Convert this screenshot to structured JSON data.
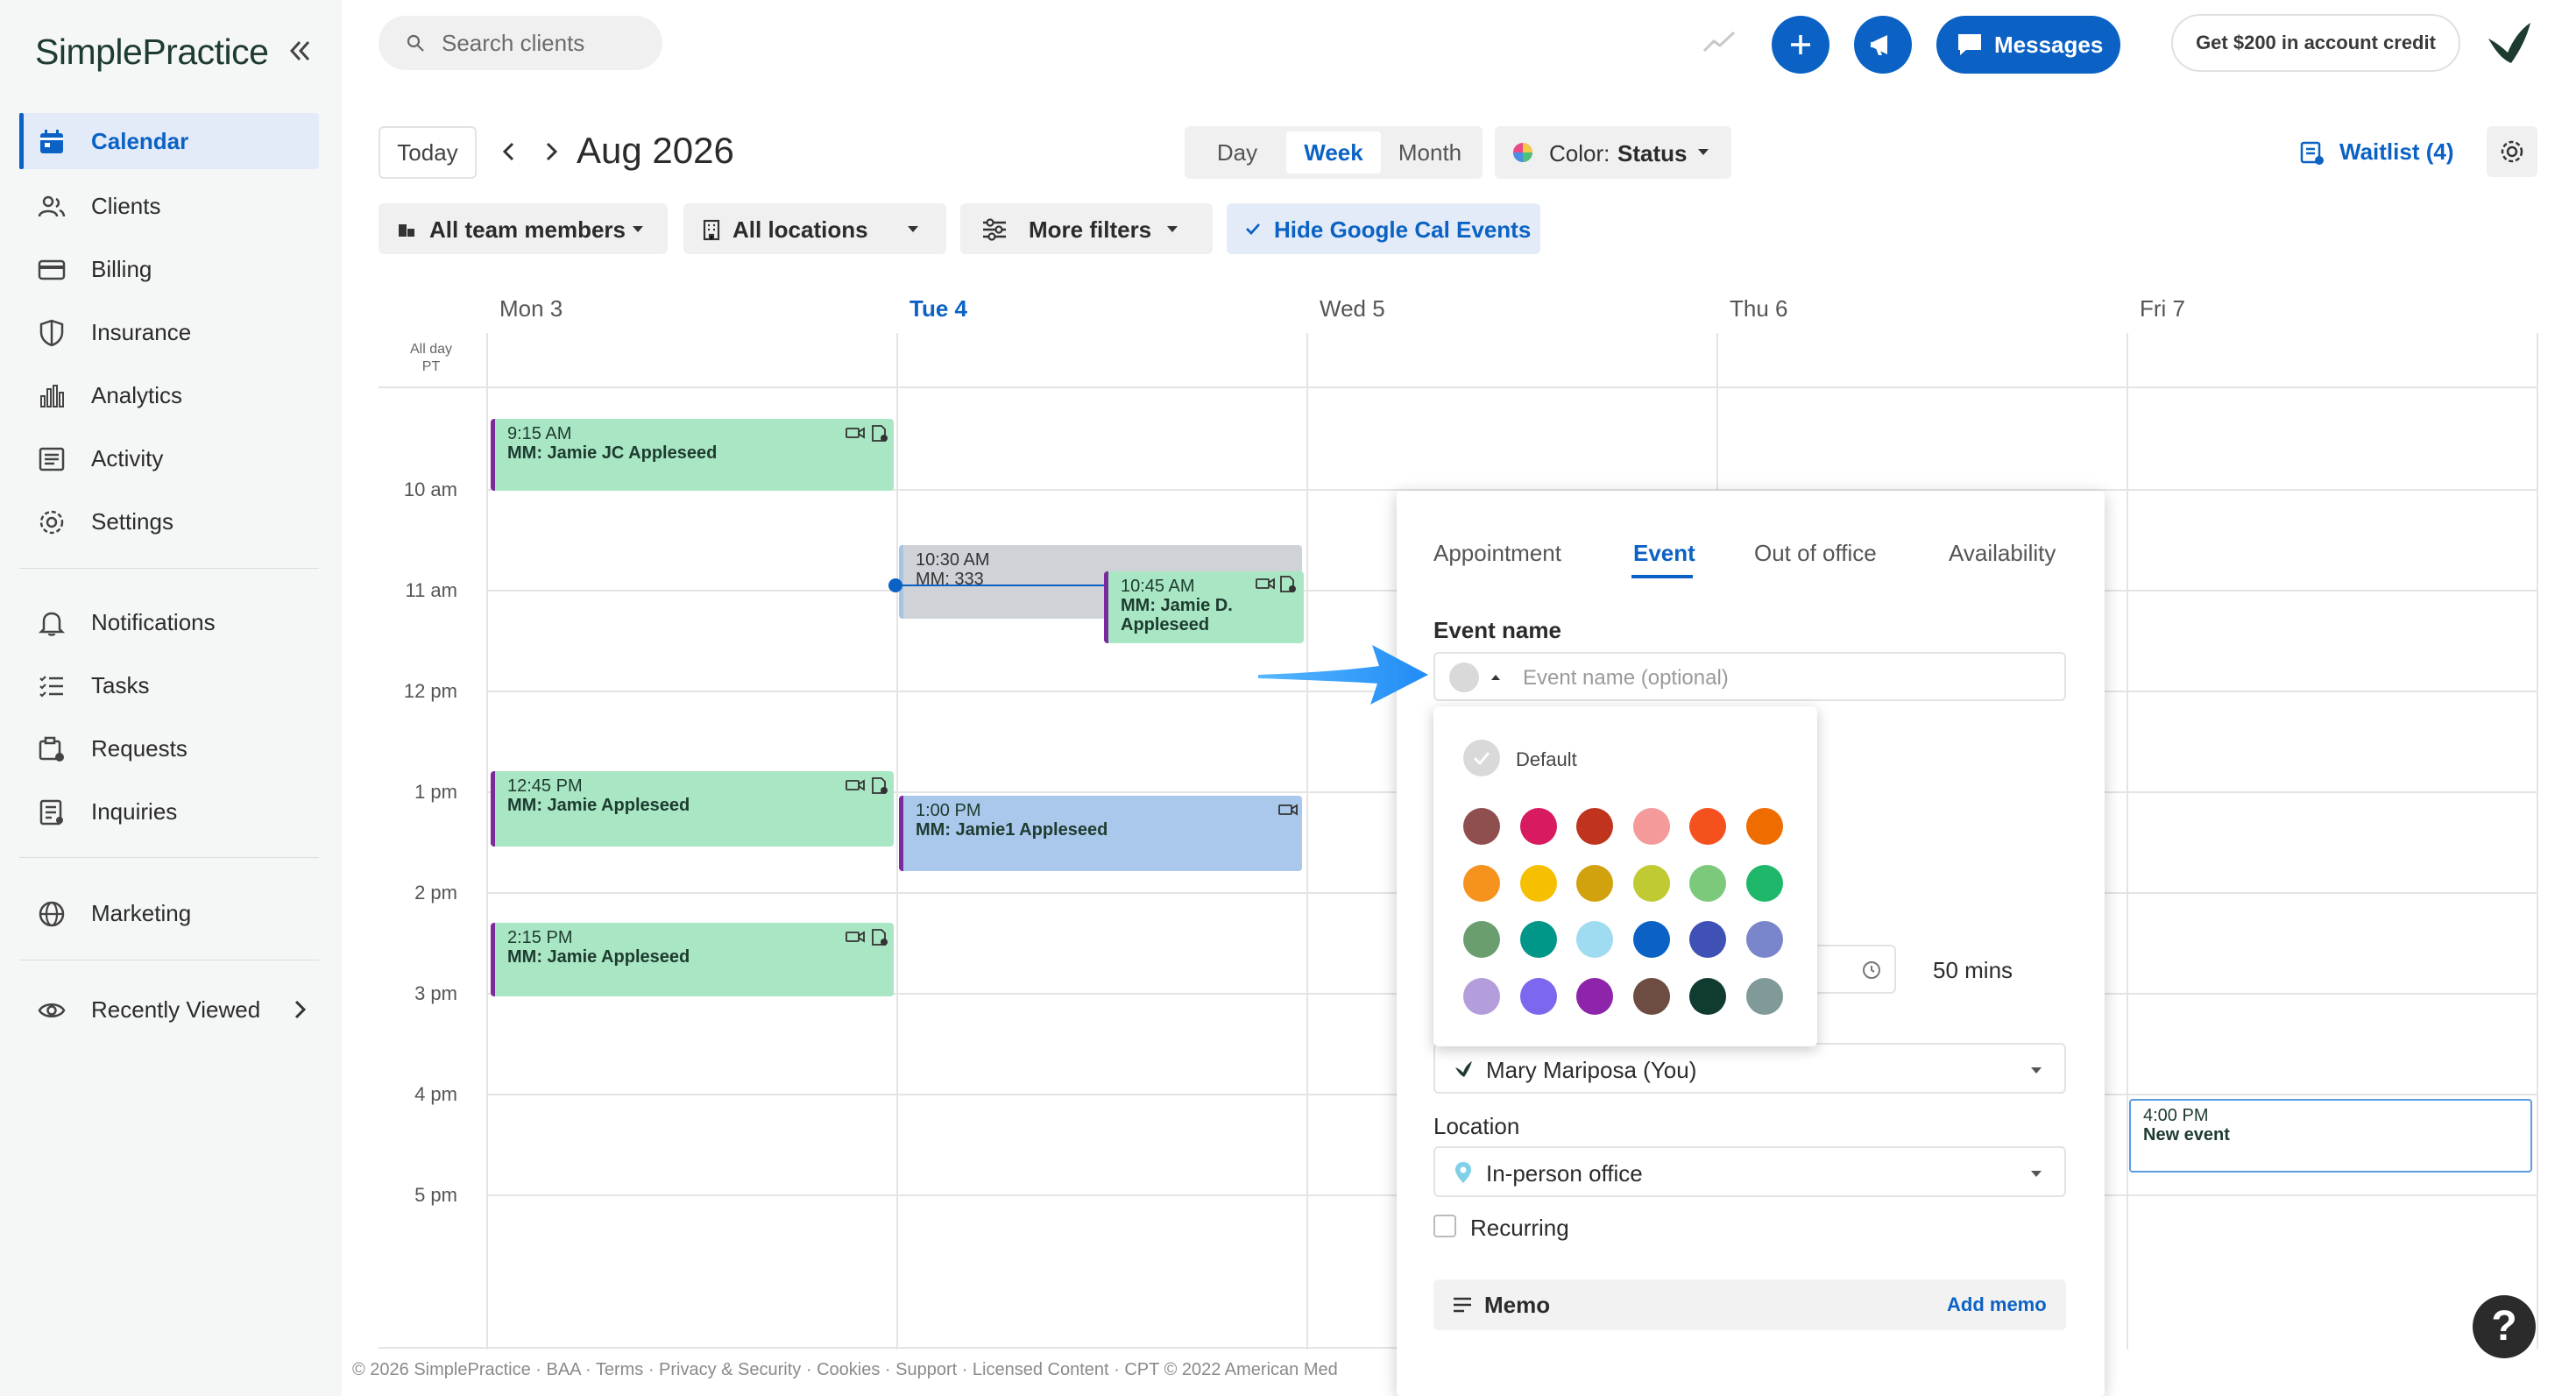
{
  "app": {
    "logo": "SimplePractice"
  },
  "sidebar": {
    "items": [
      {
        "label": "Calendar",
        "icon": "calendar-icon"
      },
      {
        "label": "Clients",
        "icon": "clients-icon"
      },
      {
        "label": "Billing",
        "icon": "billing-icon"
      },
      {
        "label": "Insurance",
        "icon": "shield-icon"
      },
      {
        "label": "Analytics",
        "icon": "analytics-icon"
      },
      {
        "label": "Activity",
        "icon": "activity-icon"
      },
      {
        "label": "Settings",
        "icon": "gear-icon"
      },
      {
        "label": "Notifications",
        "icon": "bell-icon"
      },
      {
        "label": "Tasks",
        "icon": "tasks-icon"
      },
      {
        "label": "Requests",
        "icon": "requests-icon"
      },
      {
        "label": "Inquiries",
        "icon": "inquiries-icon"
      },
      {
        "label": "Marketing",
        "icon": "globe-icon"
      },
      {
        "label": "Recently Viewed",
        "icon": "eye-icon"
      }
    ]
  },
  "topbar": {
    "search_placeholder": "Search clients",
    "messages_label": "Messages",
    "credit_label": "Get $200 in account credit"
  },
  "toolbar": {
    "today_label": "Today",
    "month_label": "Aug 2026",
    "views": [
      "Day",
      "Week",
      "Month"
    ],
    "active_view": "Week",
    "color_label": "Color:",
    "color_value": "Status",
    "waitlist_label": "Waitlist (4)",
    "filters": {
      "team": "All team members",
      "locations": "All locations",
      "more": "More filters",
      "google": "Hide Google Cal Events"
    }
  },
  "calendar": {
    "days": [
      "Mon 3",
      "Tue 4",
      "Wed 5",
      "Thu 6",
      "Fri 7"
    ],
    "allday_label": "All day",
    "tz_label": "PT",
    "hours": [
      "10 am",
      "11 am",
      "12 pm",
      "1 pm",
      "2 pm",
      "3 pm",
      "4 pm",
      "5 pm"
    ],
    "appointments": [
      {
        "time": "9:15 AM",
        "name": "MM: Jamie JC Appleseed"
      },
      {
        "time": "10:30 AM",
        "name": "MM: 333"
      },
      {
        "time": "10:45 AM",
        "name": "MM: Jamie D. Appleseed"
      },
      {
        "time": "12:45 PM",
        "name": "MM: Jamie Appleseed"
      },
      {
        "time": "1:00 PM",
        "name": "MM: Jamie1 Appleseed"
      },
      {
        "time": "2:15 PM",
        "name": "MM: Jamie Appleseed"
      },
      {
        "time": "4:00 PM",
        "name": "New event"
      }
    ]
  },
  "panel": {
    "tabs": [
      "Appointment",
      "Event",
      "Out of office",
      "Availability"
    ],
    "active_tab": "Event",
    "event_name_label": "Event name",
    "event_name_placeholder": "Event name (optional)",
    "duration": "50 mins",
    "clinician": "Mary Mariposa (You)",
    "location_label": "Location",
    "location_value": "In-person office",
    "recurring_label": "Recurring",
    "memo_label": "Memo",
    "add_memo_label": "Add memo"
  },
  "color_picker": {
    "default_label": "Default",
    "colors": [
      "#8f4f4f",
      "#d81b60",
      "#c0341d",
      "#f49a9a",
      "#f4511e",
      "#ef6c00",
      "#f6921e",
      "#f6c000",
      "#d1a10e",
      "#c0ca33",
      "#7cc97c",
      "#1fb86a",
      "#6b9e6e",
      "#009688",
      "#9fdcf2",
      "#0b62c4",
      "#3f51b5",
      "#7986cb",
      "#b39ddb",
      "#7b68ee",
      "#8e24aa",
      "#6d4c41",
      "#0f3b31",
      "#7f9a98"
    ]
  },
  "footer": {
    "text": "© 2026 SimplePractice · BAA · Terms · Privacy & Security · Cookies · Support · Licensed Content · CPT © 2022 American Med"
  },
  "help_label": "?"
}
